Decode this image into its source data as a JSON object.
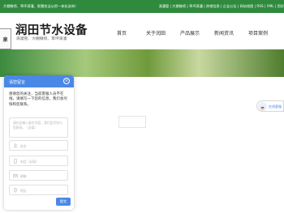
{
  "topbar": {
    "tagline": "大棚微喷、草坪滴灌，智慧农业从把一体化咨询！",
    "links": "滴灌管 | 大棚微喷 | 草坪滴灌 | 热销信息 | 企业公告 | 网站地图 | RSS | XML | 您好"
  },
  "header": {
    "logo_char": "泉",
    "brand_name": "润田节水设备",
    "brand_sub": "滴灌管、大棚微喷、草坪滴灌"
  },
  "nav": {
    "items": [
      "首页",
      "关于润田",
      "产品展示",
      "新闻资讯",
      "项目案例"
    ]
  },
  "chat": {
    "title": "请您留言",
    "close_symbol": "×",
    "message": "感谢您的关注，当前客服人员不在线，请填写一下您的信息，我们会尽快和您联系。",
    "textarea_placeholder": "请在此输入留言内容，我们会尽快与您联系。（必填）",
    "fields": [
      {
        "placeholder": "姓名",
        "icon": "user-icon"
      },
      {
        "placeholder": "电话（必填）",
        "icon": "phone-icon"
      },
      {
        "placeholder": "邮箱",
        "icon": "mail-icon"
      },
      {
        "placeholder": "地址",
        "icon": "location-icon"
      }
    ],
    "submit_label": "提交"
  },
  "service": {
    "label": "在线客服"
  },
  "colors": {
    "topbar_green": "#2f8a3e",
    "chat_blue": "#4b88e6"
  }
}
